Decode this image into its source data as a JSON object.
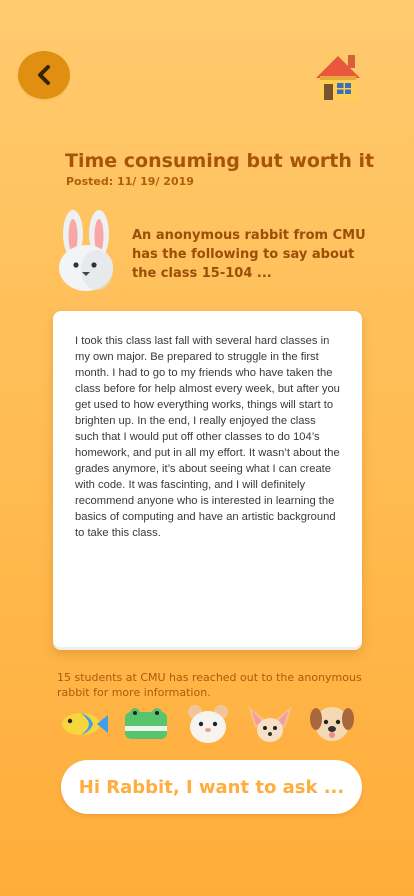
{
  "header": {
    "back_icon": "chevron-left-icon",
    "home_icon": "house-icon"
  },
  "post": {
    "title": "Time consuming but worth it",
    "posted": "Posted: 11/ 19/ 2019",
    "author_icon": "rabbit-icon",
    "intro": "An anonymous rabbit from CMU has the following to say about the class 15-104 ...",
    "body": "I took this class last fall with several hard classes in my own major. Be prepared to struggle in the first month. I had to go to my friends who have taken the class before for help almost every week, but after you get used to how everything works, things will start to brighten up. In the end, I really enjoyed the class such that I would put off other classes to do 104’s homework, and put in all my effort. It wasn’t about the grades anymore, it’s about seeing what I can create with code. It was fascinting, and I will definitely recommend anyone who is interested in learning the basics of computing and have an artistic background to take this class."
  },
  "reach": {
    "count_text": "15 students at CMU has reached out to the anonymous rabbit for more information.",
    "avatars": [
      "fish-icon",
      "crocodile-icon",
      "hamster-icon",
      "fennec-fox-icon",
      "dog-icon"
    ]
  },
  "ask_button": {
    "label": "Hi Rabbit, I want to ask ..."
  },
  "colors": {
    "accent": "#ffad3e",
    "title": "#a7540a",
    "back_button": "#e08f10"
  }
}
